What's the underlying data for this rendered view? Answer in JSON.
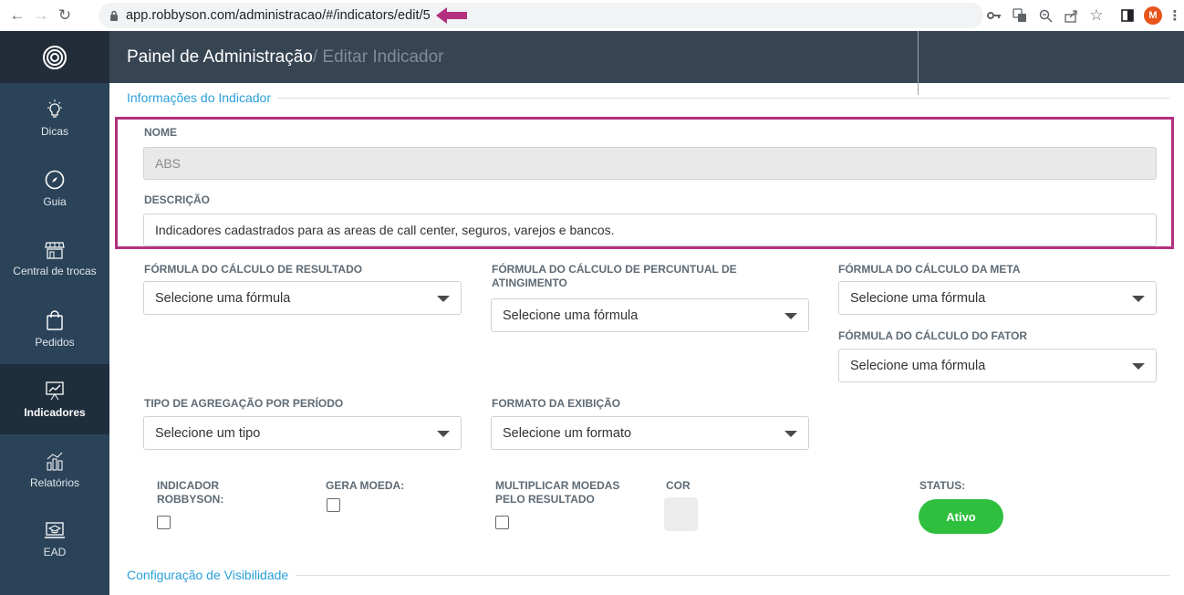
{
  "browser": {
    "url": "app.robbyson.com/administracao/#/indicators/edit/5",
    "avatar_letter": "M",
    "annotation_color": "#b2307e"
  },
  "sidebar": {
    "items": [
      {
        "label": "Dicas",
        "icon": "lightbulb-icon"
      },
      {
        "label": "Guia",
        "icon": "compass-icon"
      },
      {
        "label": "Central de trocas",
        "icon": "store-icon"
      },
      {
        "label": "Pedidos",
        "icon": "shopping-bag-icon"
      },
      {
        "label": "Indicadores",
        "icon": "chart-board-icon",
        "active": true
      },
      {
        "label": "Relatórios",
        "icon": "bar-chart-icon"
      },
      {
        "label": "EAD",
        "icon": "laptop-graduation-icon"
      }
    ]
  },
  "header": {
    "title": "Painel de Administração",
    "subtitle": " / Editar Indicador"
  },
  "form": {
    "section_info": "Informações do Indicador",
    "nome_label": "NOME",
    "nome_value": "ABS",
    "descricao_label": "DESCRIÇÃO",
    "descricao_value": "Indicadores cadastrados para as areas de call center, seguros,  varejos e bancos.",
    "formula_resultado_label": "FÓRMULA DO CÁLCULO DE RESULTADO",
    "formula_resultado_value": "Selecione uma fórmula",
    "formula_percentual_label_1": "FÓRMULA DO CÁLCULO DE PERCUNTUAL DE",
    "formula_percentual_label_2": "ATINGIMENTO",
    "formula_percentual_value": "Selecione uma fórmula",
    "formula_meta_label": "FÓRMULA DO CÁLCULO DA META",
    "formula_meta_value": "Selecione uma fórmula",
    "formula_fator_label": "FÓRMULA DO CÁLCULO DO FATOR",
    "formula_fator_value": "Selecione uma fórmula",
    "agregacao_label": "TIPO DE AGREGAÇÃO POR PERÍODO",
    "agregacao_value": "Selecione um tipo",
    "formato_label": "FORMATO DA EXIBIÇÃO",
    "formato_value": "Selecione um formato",
    "indicador_robbyson_label_1": "INDICADOR",
    "indicador_robbyson_label_2": "ROBBYSON:",
    "gera_moeda_label": "GERA MOEDA:",
    "multiplicar_label_1": "MULTIPLICAR MOEDAS",
    "multiplicar_label_2": "PELO RESULTADO",
    "cor_label": "COR",
    "status_label": "STATUS:",
    "status_value": "Ativo",
    "section_visibility": "Configuração de Visibilidade"
  },
  "colors": {
    "sidebar_bg": "#2b4358",
    "header_bg": "#374553",
    "accent_blue": "#2a9fd8",
    "status_green": "#2fbf3f"
  }
}
